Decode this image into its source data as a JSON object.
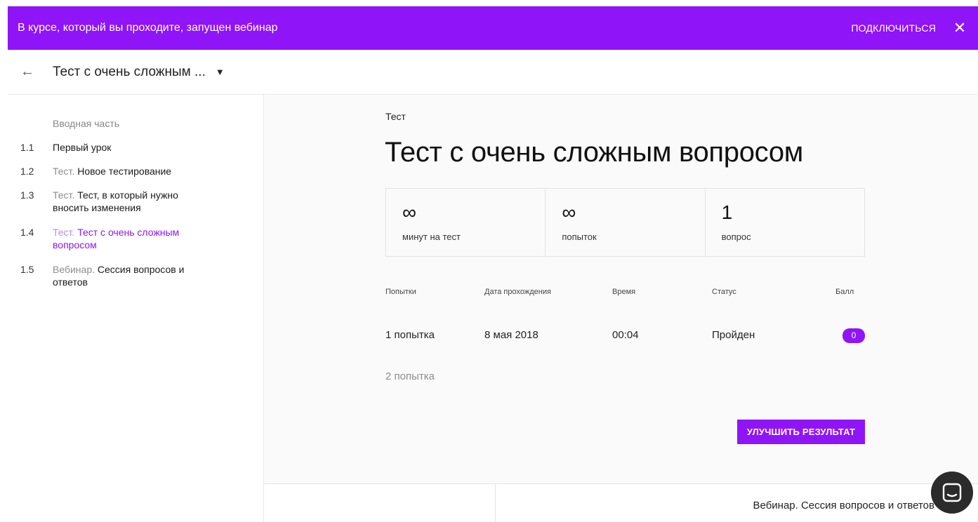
{
  "banner": {
    "message": "В курсе, который вы проходите, запущен вебинар",
    "join_label": "ПОДКЛЮЧИТЬСЯ",
    "close_glyph": "✕"
  },
  "topbar": {
    "back_glyph": "←",
    "course_title": "Тест с очень сложным ...",
    "caret_glyph": "▼"
  },
  "sidebar": {
    "intro": "Вводная часть",
    "lessons": [
      {
        "num": "1.1",
        "kind": "",
        "title": "Первый урок"
      },
      {
        "num": "1.2",
        "kind": "Тест.",
        "title": "Новое тестирование"
      },
      {
        "num": "1.3",
        "kind": "Тест.",
        "title": "Тест, в который нужно вносить изменения"
      },
      {
        "num": "1.4",
        "kind": "Тест.",
        "title": "Тест с очень сложным вопросом"
      },
      {
        "num": "1.5",
        "kind": "Вебинар.",
        "title": "Сессия вопросов и ответов"
      }
    ]
  },
  "main": {
    "crumb": "Тест",
    "title": "Тест с очень сложным вопросом",
    "stats": [
      {
        "value": "∞",
        "label": "минут на тест"
      },
      {
        "value": "∞",
        "label": "попыток"
      },
      {
        "value": "1",
        "label": "вопрос"
      }
    ],
    "table": {
      "headers": [
        "Попытки",
        "Дата прохождения",
        "Время",
        "Статус",
        "Балл"
      ],
      "row1": {
        "attempt": "1 попытка",
        "date": "8 мая 2018",
        "time": "00:04",
        "status": "Пройден",
        "score": "0"
      },
      "row2": {
        "attempt": "2 попытка"
      }
    },
    "improve_label": "УЛУЧШИТЬ РЕЗУЛЬТАТ"
  },
  "bottom_nav": {
    "next_label": "Вебинар. Сессия вопросов и ответов"
  },
  "colors": {
    "accent": "#8f14f7",
    "chat_button": "#2b2b2b"
  },
  "icons": {
    "back": "arrow-left-icon",
    "close": "close-icon",
    "caret": "caret-down-icon",
    "chat": "chat-icon"
  }
}
